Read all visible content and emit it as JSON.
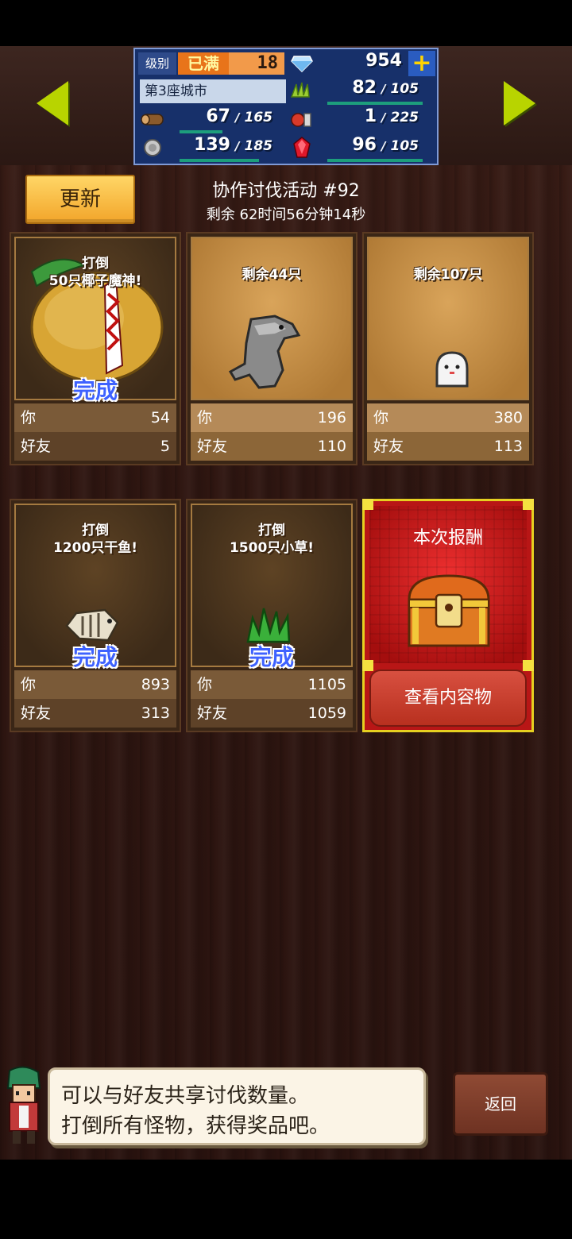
{
  "hud": {
    "level_label": "级别",
    "level_max": "已满",
    "level": "18",
    "gems": "954",
    "city": "第3座城市",
    "grass": "82",
    "grass_max": "105",
    "wood": "67",
    "wood_max": "165",
    "food": "1",
    "food_max": "225",
    "ore": "139",
    "ore_max": "185",
    "ruby": "96",
    "ruby_max": "105",
    "slash": "/"
  },
  "event": {
    "refresh_label": "更新",
    "title": "协作讨伐活动 #92",
    "time_left": "剩余 62时间56分钟14秒"
  },
  "labels": {
    "you": "你",
    "friend": "好友",
    "done": "完成"
  },
  "cards": [
    {
      "line1": "打倒",
      "line2": "50只椰子魔神!",
      "you": "54",
      "friend": "5",
      "status": "done"
    },
    {
      "line1": "剩余44只",
      "line2": "",
      "you": "196",
      "friend": "110",
      "status": "active"
    },
    {
      "line1": "剩余107只",
      "line2": "",
      "you": "380",
      "friend": "113",
      "status": "active"
    },
    {
      "line1": "打倒",
      "line2": "1200只干鱼!",
      "you": "893",
      "friend": "313",
      "status": "done"
    },
    {
      "line1": "打倒",
      "line2": "1500只小草!",
      "you": "1105",
      "friend": "1059",
      "status": "done"
    }
  ],
  "reward": {
    "title": "本次报酬",
    "button": "查看内容物"
  },
  "dialog": {
    "line1": "可以与好友共享讨伐数量。",
    "line2": "打倒所有怪物，获得奖品吧。"
  },
  "back_label": "返回"
}
